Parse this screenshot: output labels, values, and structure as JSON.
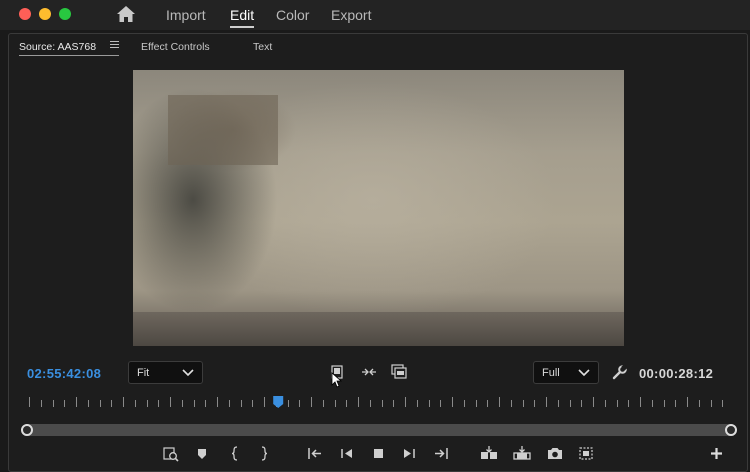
{
  "workspace": {
    "tabs": [
      {
        "label": "Import"
      },
      {
        "label": "Edit"
      },
      {
        "label": "Color"
      },
      {
        "label": "Export"
      }
    ],
    "active_tab": "Edit"
  },
  "panel": {
    "tabs": [
      {
        "label": "Source: AAS768"
      },
      {
        "label": "Effect Controls"
      },
      {
        "label": "Text"
      }
    ]
  },
  "monitor": {
    "current_timecode": "02:55:42:08",
    "duration_timecode": "00:00:28:12",
    "zoom_value": "Fit",
    "resolution_value": "Full",
    "playhead_fraction": 0.355
  },
  "colors": {
    "accent": "#3a8fe0",
    "playhead": "#3a8fe0"
  }
}
